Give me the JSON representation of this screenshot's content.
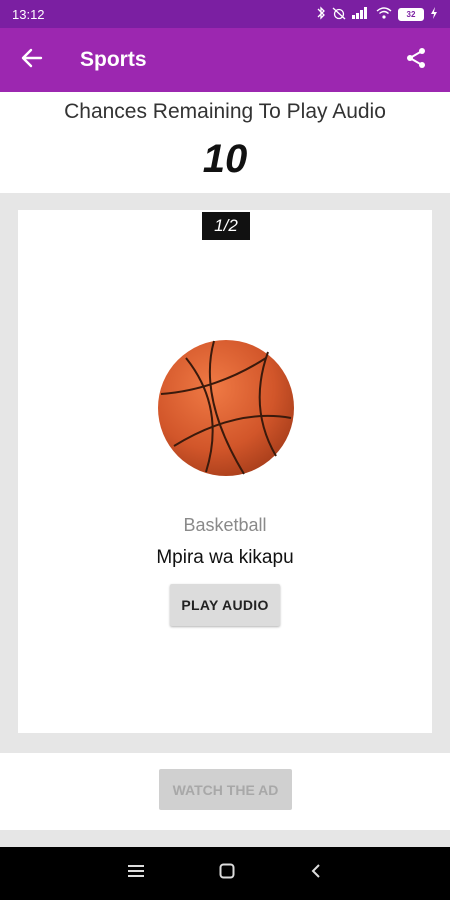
{
  "status_bar": {
    "time": "13:12",
    "battery": "32",
    "icons": [
      "bluetooth-icon",
      "alarm-off-icon",
      "signal-icon",
      "wifi-icon",
      "battery-icon",
      "charging-icon"
    ]
  },
  "app_bar": {
    "title": "Sports",
    "color": "#9c27b0",
    "status_color": "#7b1fa2"
  },
  "chances": {
    "label": "Chances Remaining To Play Audio",
    "count": "10"
  },
  "card": {
    "page_indicator": "1/2",
    "image_icon": "basketball-icon",
    "word_english": "Basketball",
    "word_swahili": "Mpira wa kikapu",
    "play_label": "PLAY AUDIO"
  },
  "ad": {
    "label": "WATCH THE AD"
  },
  "nav": {
    "icons": [
      "menu-icon",
      "home-square-icon",
      "back-chevron-icon"
    ]
  }
}
